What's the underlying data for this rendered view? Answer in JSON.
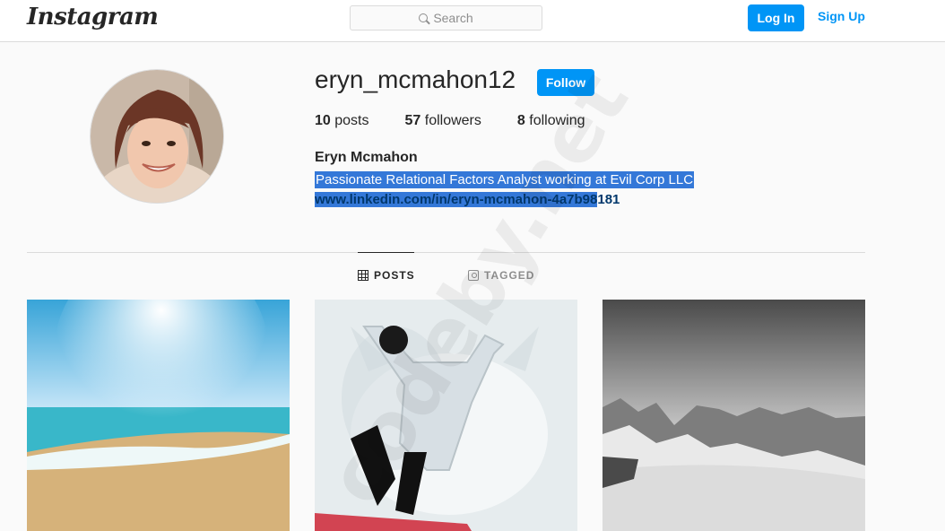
{
  "header": {
    "logo_text": "Instagram",
    "search_placeholder": "Search",
    "login_label": "Log In",
    "signup_label": "Sign Up"
  },
  "profile": {
    "username": "eryn_mcmahon12",
    "follow_label": "Follow",
    "stats": {
      "posts_count": "10",
      "posts_label": "posts",
      "followers_count": "57",
      "followers_label": "followers",
      "following_count": "8",
      "following_label": "following"
    },
    "full_name": "Eryn Mcmahon",
    "bio": "Passionate Relational Factors Analyst working at Evil Corp LLC",
    "website_highlighted": "www.linkedin.com/in/eryn-mcmahon-4a7b98",
    "website_rest": "181"
  },
  "tabs": {
    "posts_label": "POSTS",
    "tagged_label": "TAGGED"
  },
  "posts": [
    {
      "icon": "beach-photo"
    },
    {
      "icon": "snow-angel-photo"
    },
    {
      "icon": "mountain-photo"
    }
  ],
  "watermark": "codeby.net",
  "colors": {
    "accent": "#0095f6",
    "selection": "#3478d8",
    "link": "#00376b"
  }
}
